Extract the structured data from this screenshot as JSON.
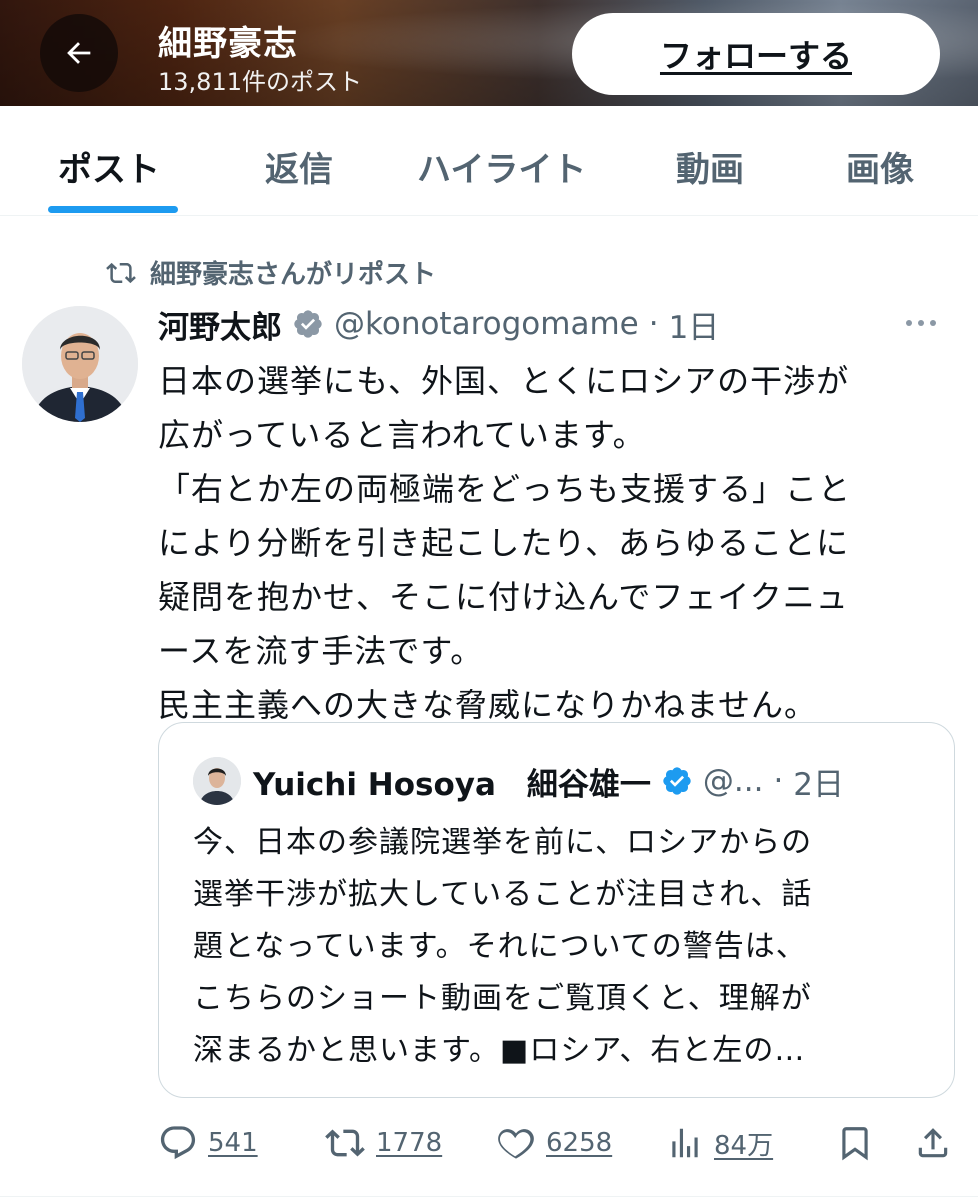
{
  "header": {
    "title": "細野豪志",
    "subtitle": "13,811件のポスト",
    "follow_label": "フォローする"
  },
  "tabs": [
    {
      "label": "ポスト",
      "active": true
    },
    {
      "label": "返信"
    },
    {
      "label": "ハイライト"
    },
    {
      "label": "動画"
    },
    {
      "label": "画像"
    }
  ],
  "repost": {
    "label": "細野豪志さんがリポスト"
  },
  "post": {
    "author_name": "河野太郎",
    "handle": "@konotarogomame",
    "separator": "·",
    "time": "1日",
    "text": "日本の選挙にも、外国、とくにロシアの干渉が\n広がっていると言われています。\n「右とか左の両極端をどっちも支援する」こと\nにより分断を引き起こしたり、あらゆることに\n疑問を抱かせ、そこに付け込んでフェイクニュ\nースを流す手法です。\n民主主義への大きな脅威になりかねません。"
  },
  "quote": {
    "author_name": "Yuichi Hosoya　細谷雄一",
    "handle": "@...",
    "separator": "·",
    "time": "2日",
    "text": "今、日本の参議院選挙を前に、ロシアからの\n選挙干渉が拡大していることが注目され、話\n題となっています。それについての警告は、\nこちらのショート動画をご覧頂くと、理解が\n深まるかと思います。■ロシア、右と左の…"
  },
  "actions": {
    "replies": "541",
    "reposts": "1778",
    "likes": "6258",
    "views": "84万"
  },
  "colors": {
    "accent": "#1d9bf0",
    "secondary_text": "#536471",
    "primary_text": "#0f1419"
  }
}
